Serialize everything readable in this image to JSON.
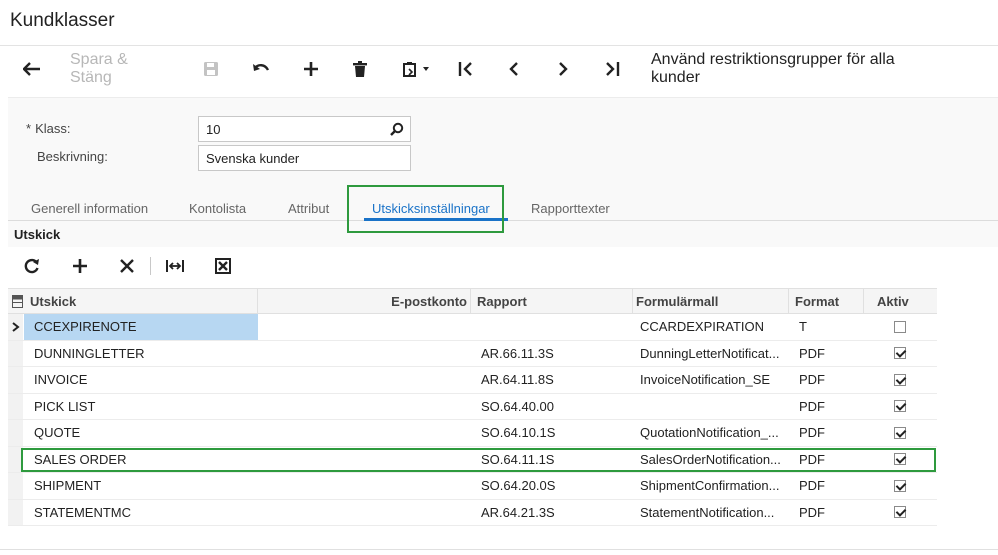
{
  "page": {
    "title": "Kundklasser"
  },
  "toolbar": {
    "save_close_label": "Spara & Stäng",
    "apply_restriction_label": "Använd restriktionsgrupper för alla kunder"
  },
  "form": {
    "class_label": "Klass:",
    "class_value": "10",
    "description_label": "Beskrivning:",
    "description_value": "Svenska kunder"
  },
  "tabs": [
    {
      "label": "Generell information",
      "active": false
    },
    {
      "label": "Kontolista",
      "active": false
    },
    {
      "label": "Attribut",
      "active": false
    },
    {
      "label": "Utskicksinställningar",
      "active": true
    },
    {
      "label": "Rapporttexter",
      "active": false
    }
  ],
  "section": {
    "title": "Utskick"
  },
  "grid": {
    "columns": {
      "mailing": "Utskick",
      "email_account": "E-postkonto",
      "report": "Rapport",
      "template": "Formulärmall",
      "format": "Format",
      "active": "Aktiv"
    },
    "rows": [
      {
        "mailing": "CCEXPIRENOTE",
        "email_account": "",
        "report": "",
        "template": "CCARDEXPIRATION",
        "format": "T",
        "active": false
      },
      {
        "mailing": "DUNNINGLETTER",
        "email_account": "",
        "report": "AR.66.11.3S",
        "template": "DunningLetterNotificat...",
        "format": "PDF",
        "active": true
      },
      {
        "mailing": "INVOICE",
        "email_account": "",
        "report": "AR.64.11.8S",
        "template": "InvoiceNotification_SE",
        "format": "PDF",
        "active": true
      },
      {
        "mailing": "PICK LIST",
        "email_account": "",
        "report": "SO.64.40.00",
        "template": "",
        "format": "PDF",
        "active": true
      },
      {
        "mailing": "QUOTE",
        "email_account": "",
        "report": "SO.64.10.1S",
        "template": "QuotationNotification_...",
        "format": "PDF",
        "active": true
      },
      {
        "mailing": "SALES ORDER",
        "email_account": "",
        "report": "SO.64.11.1S",
        "template": "SalesOrderNotification...",
        "format": "PDF",
        "active": true
      },
      {
        "mailing": "SHIPMENT",
        "email_account": "",
        "report": "SO.64.20.0S",
        "template": "ShipmentConfirmation...",
        "format": "PDF",
        "active": true
      },
      {
        "mailing": "STATEMENTMC",
        "email_account": "",
        "report": "AR.64.21.3S",
        "template": "StatementNotification...",
        "format": "PDF",
        "active": true
      }
    ]
  },
  "colors": {
    "accent": "#1a73c8",
    "highlight_box": "#2e9a3e",
    "selected_cell": "#b7d7f2",
    "disabled_text": "#b7b7b7"
  }
}
